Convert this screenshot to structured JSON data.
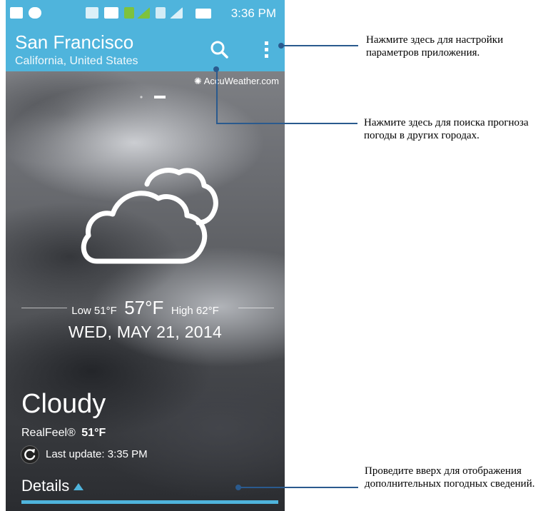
{
  "status_bar": {
    "time": "3:36 PM"
  },
  "header": {
    "city": "San Francisco",
    "region": "California, United States"
  },
  "provider": "AccuWeather.com",
  "weather": {
    "low_label": "Low 51°F",
    "current_temp": "57°F",
    "high_label": "High 62°F",
    "date": "WED, MAY 21, 2014",
    "condition": "Cloudy",
    "realfeel_label": "RealFeel®",
    "realfeel_value": "51°F",
    "last_update": "Last update: 3:35 PM",
    "icon": "cloudy-icon"
  },
  "details_label": "Details",
  "annotations": {
    "settings": "Нажмите здесь для настройки параметров приложения.",
    "search": "Нажмите здесь для поиска прогноза погоды в других городах.",
    "swipe": "Проведите вверх для отображения дополнительных погодных сведений."
  },
  "colors": {
    "accent": "#4fb4dc",
    "leader_line": "#2a5a8e"
  }
}
